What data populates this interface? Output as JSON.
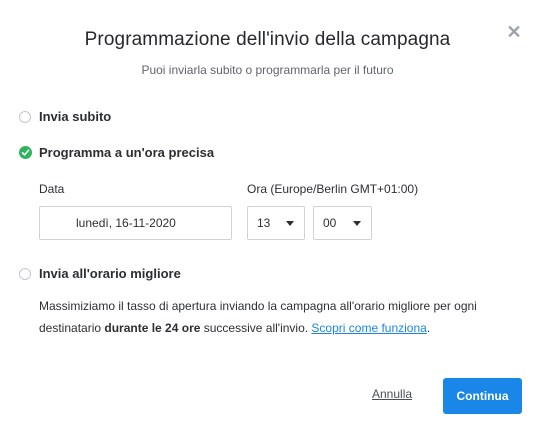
{
  "dialog": {
    "title": "Programmazione dell'invio della campagna",
    "subtitle": "Puoi inviarla subito o programmarla per il futuro"
  },
  "options": {
    "now": {
      "label": "Invia subito",
      "selected": false
    },
    "scheduled": {
      "label": "Programma a un'ora precisa",
      "selected": true
    },
    "best": {
      "label": "Invia all'orario migliore",
      "selected": false
    }
  },
  "schedule": {
    "date_label": "Data",
    "date_value": "lunedì, 16-11-2020",
    "time_label": "Ora (Europe/Berlin GMT+01:00)",
    "hour_value": "13",
    "minute_value": "00"
  },
  "best_time_description": {
    "part1": "Massimiziamo il tasso di apertura inviando la campagna all'orario migliore per ogni destinatario ",
    "bold": "durante le 24 ore",
    "part2": " successive all'invio. ",
    "link": "Scopri come funziona",
    "end": "."
  },
  "footer": {
    "cancel_label": "Annulla",
    "continue_label": "Continua"
  },
  "colors": {
    "accent": "#1a86e8",
    "success": "#2fb35e"
  }
}
